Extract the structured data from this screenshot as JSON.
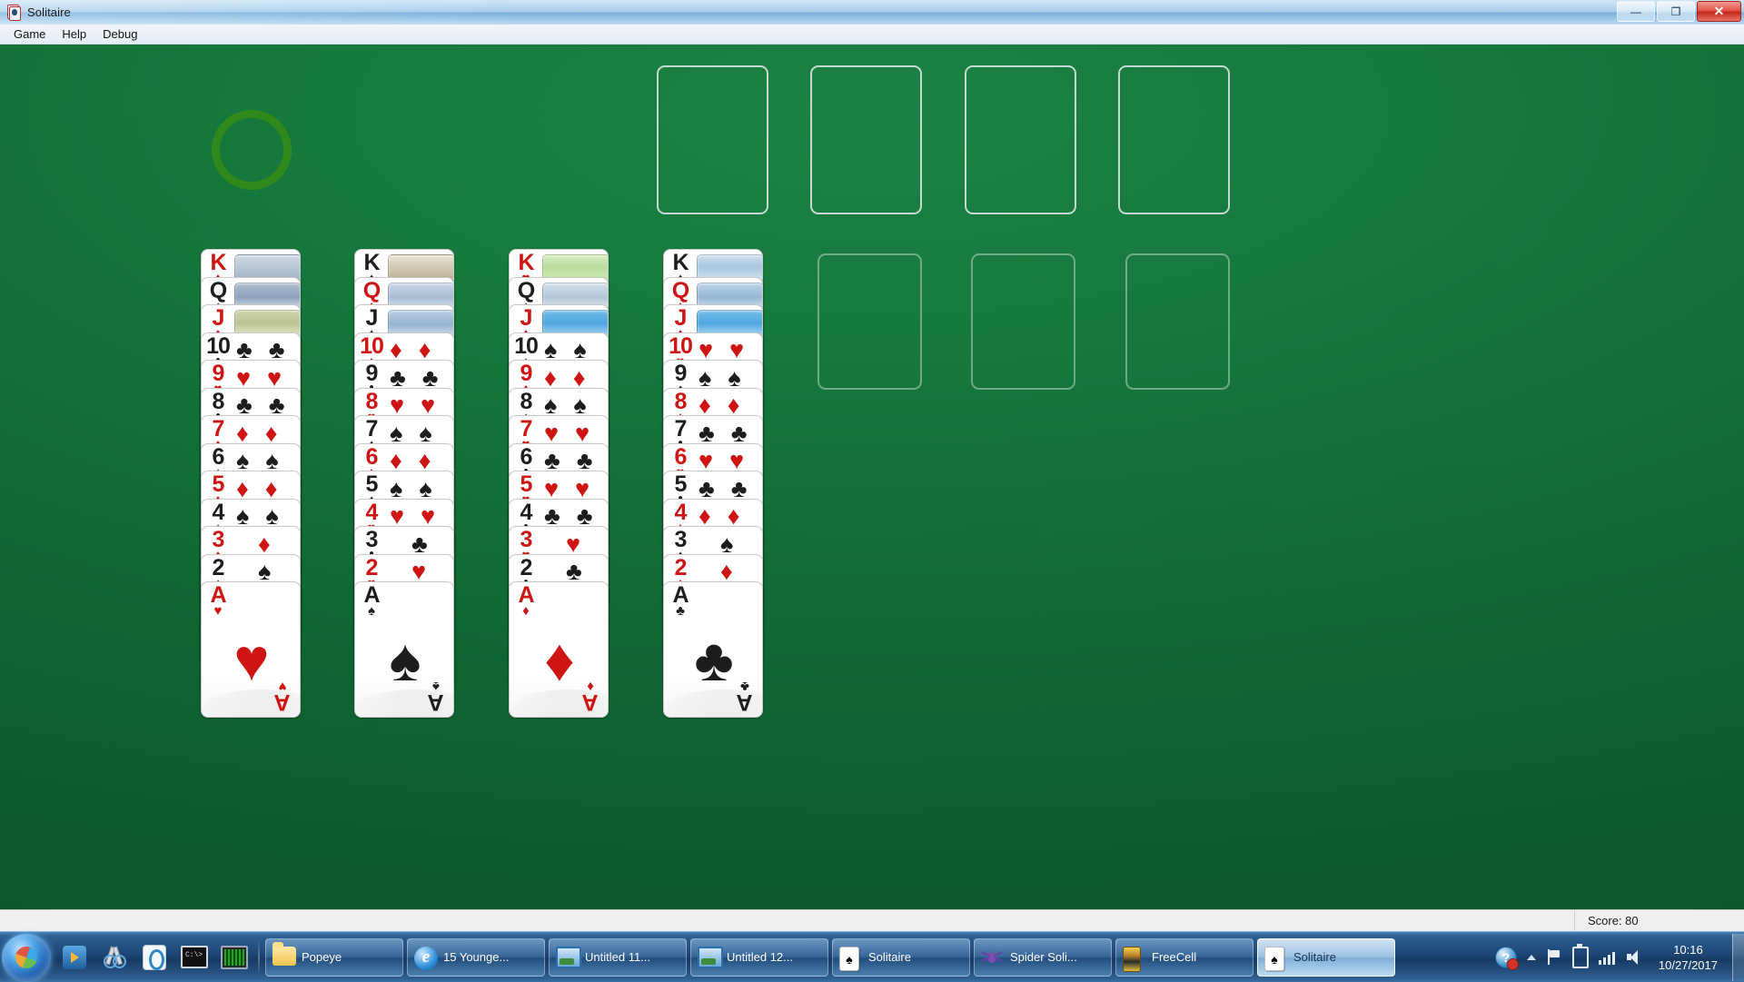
{
  "window": {
    "title": "Solitaire",
    "icon": "solitaire-card-icon",
    "buttons": {
      "minimize": "—",
      "maximize": "❐",
      "close": "✕"
    }
  },
  "menubar": {
    "items": [
      "Game",
      "Help",
      "Debug"
    ]
  },
  "statusbar": {
    "score_label": "Score: 80"
  },
  "board": {
    "stock_icon": "empty-stock-ring",
    "foundations": [
      {
        "name": "foundation-1",
        "empty": true
      },
      {
        "name": "foundation-2",
        "empty": true
      },
      {
        "name": "foundation-3",
        "empty": true
      },
      {
        "name": "foundation-4",
        "empty": true
      }
    ],
    "empty_tableau_slots": [
      {
        "name": "tableau-slot-5",
        "empty": true
      },
      {
        "name": "tableau-slot-6",
        "empty": true
      },
      {
        "name": "tableau-slot-7",
        "empty": true
      }
    ],
    "suit_glyphs": {
      "hearts": "♥",
      "diamonds": "♦",
      "spades": "♠",
      "clubs": "♣"
    },
    "colors": {
      "red": "#cf1414",
      "black": "#1d1d1d",
      "felt": "#14773b",
      "slot_outline": "#ebf0ee",
      "ring": "#2f8a18"
    },
    "columns": [
      {
        "name": "tableau-column-1",
        "cards": [
          {
            "rank": "K",
            "suit": "♦",
            "color": "red",
            "face": true,
            "pic": "pic-k1"
          },
          {
            "rank": "Q",
            "suit": "♠",
            "color": "black",
            "face": true,
            "pic": "pic-q1"
          },
          {
            "rank": "J",
            "suit": "♦",
            "color": "red",
            "face": true,
            "pic": "pic-j1"
          },
          {
            "rank": "10",
            "suit": "♣",
            "color": "black",
            "pips": 2
          },
          {
            "rank": "9",
            "suit": "♥",
            "color": "red",
            "pips": 2
          },
          {
            "rank": "8",
            "suit": "♣",
            "color": "black",
            "pips": 2
          },
          {
            "rank": "7",
            "suit": "♦",
            "color": "red",
            "pips": 2
          },
          {
            "rank": "6",
            "suit": "♠",
            "color": "black",
            "pips": 2
          },
          {
            "rank": "5",
            "suit": "♦",
            "color": "red",
            "pips": 2
          },
          {
            "rank": "4",
            "suit": "♠",
            "color": "black",
            "pips": 2
          },
          {
            "rank": "3",
            "suit": "♦",
            "color": "red",
            "pips": 1
          },
          {
            "rank": "2",
            "suit": "♠",
            "color": "black",
            "pips": 1
          },
          {
            "rank": "A",
            "suit": "♥",
            "color": "red",
            "ace": true
          }
        ]
      },
      {
        "name": "tableau-column-2",
        "cards": [
          {
            "rank": "K",
            "suit": "♠",
            "color": "black",
            "face": true,
            "pic": "pic-k2"
          },
          {
            "rank": "Q",
            "suit": "♦",
            "color": "red",
            "face": true,
            "pic": "pic-q2"
          },
          {
            "rank": "J",
            "suit": "♠",
            "color": "black",
            "face": true,
            "pic": "pic-j2"
          },
          {
            "rank": "10",
            "suit": "♦",
            "color": "red",
            "pips": 2
          },
          {
            "rank": "9",
            "suit": "♣",
            "color": "black",
            "pips": 2
          },
          {
            "rank": "8",
            "suit": "♥",
            "color": "red",
            "pips": 2
          },
          {
            "rank": "7",
            "suit": "♠",
            "color": "black",
            "pips": 2
          },
          {
            "rank": "6",
            "suit": "♦",
            "color": "red",
            "pips": 2
          },
          {
            "rank": "5",
            "suit": "♠",
            "color": "black",
            "pips": 2
          },
          {
            "rank": "4",
            "suit": "♥",
            "color": "red",
            "pips": 2
          },
          {
            "rank": "3",
            "suit": "♣",
            "color": "black",
            "pips": 1
          },
          {
            "rank": "2",
            "suit": "♥",
            "color": "red",
            "pips": 1
          },
          {
            "rank": "A",
            "suit": "♠",
            "color": "black",
            "ace": true
          }
        ]
      },
      {
        "name": "tableau-column-3",
        "cards": [
          {
            "rank": "K",
            "suit": "♥",
            "color": "red",
            "face": true,
            "pic": "pic-k3"
          },
          {
            "rank": "Q",
            "suit": "♠",
            "color": "black",
            "face": true,
            "pic": "pic-q3"
          },
          {
            "rank": "J",
            "suit": "♦",
            "color": "red",
            "face": true,
            "pic": "pic-j3"
          },
          {
            "rank": "10",
            "suit": "♠",
            "color": "black",
            "pips": 2
          },
          {
            "rank": "9",
            "suit": "♦",
            "color": "red",
            "pips": 2
          },
          {
            "rank": "8",
            "suit": "♠",
            "color": "black",
            "pips": 2
          },
          {
            "rank": "7",
            "suit": "♥",
            "color": "red",
            "pips": 2
          },
          {
            "rank": "6",
            "suit": "♣",
            "color": "black",
            "pips": 2
          },
          {
            "rank": "5",
            "suit": "♥",
            "color": "red",
            "pips": 2
          },
          {
            "rank": "4",
            "suit": "♣",
            "color": "black",
            "pips": 2
          },
          {
            "rank": "3",
            "suit": "♥",
            "color": "red",
            "pips": 1
          },
          {
            "rank": "2",
            "suit": "♣",
            "color": "black",
            "pips": 1
          },
          {
            "rank": "A",
            "suit": "♦",
            "color": "red",
            "ace": true
          }
        ]
      },
      {
        "name": "tableau-column-4",
        "cards": [
          {
            "rank": "K",
            "suit": "♠",
            "color": "black",
            "face": true,
            "pic": "pic-k4"
          },
          {
            "rank": "Q",
            "suit": "♦",
            "color": "red",
            "face": true,
            "pic": "pic-q4"
          },
          {
            "rank": "J",
            "suit": "♦",
            "color": "red",
            "face": true,
            "pic": "pic-j4"
          },
          {
            "rank": "10",
            "suit": "♥",
            "color": "red",
            "pips": 2
          },
          {
            "rank": "9",
            "suit": "♠",
            "color": "black",
            "pips": 2
          },
          {
            "rank": "8",
            "suit": "♦",
            "color": "red",
            "pips": 2
          },
          {
            "rank": "7",
            "suit": "♣",
            "color": "black",
            "pips": 2
          },
          {
            "rank": "6",
            "suit": "♥",
            "color": "red",
            "pips": 2
          },
          {
            "rank": "5",
            "suit": "♣",
            "color": "black",
            "pips": 2
          },
          {
            "rank": "4",
            "suit": "♦",
            "color": "red",
            "pips": 2
          },
          {
            "rank": "3",
            "suit": "♠",
            "color": "black",
            "pips": 1
          },
          {
            "rank": "2",
            "suit": "♦",
            "color": "red",
            "pips": 1
          },
          {
            "rank": "A",
            "suit": "♣",
            "color": "black",
            "ace": true
          }
        ]
      }
    ]
  },
  "taskbar": {
    "start_button": "start-orb",
    "quick_launch": [
      {
        "name": "windows-media-player-icon",
        "class": "ic-wmp"
      },
      {
        "name": "snipping-tool-icon",
        "class": "ic-snip"
      },
      {
        "name": "windows-live-writer-icon",
        "class": "ic-wlink"
      },
      {
        "name": "command-prompt-icon",
        "class": "ic-term"
      },
      {
        "name": "system-monitor-icon",
        "class": "ic-mon"
      }
    ],
    "buttons": [
      {
        "label": "Popeye",
        "icon": "folder-icon",
        "icon_class": "ic-folder",
        "active": false
      },
      {
        "label": "15 Younge...",
        "icon": "internet-explorer-icon",
        "icon_class": "ic-ie",
        "active": false
      },
      {
        "label": "Untitled 11...",
        "icon": "picture-icon",
        "icon_class": "ic-pic",
        "active": false
      },
      {
        "label": "Untitled 12...",
        "icon": "picture-icon",
        "icon_class": "ic-pic",
        "active": false
      },
      {
        "label": "Solitaire",
        "icon": "solitaire-card-icon",
        "icon_class": "ic-card",
        "active": false
      },
      {
        "label": "Spider Soli...",
        "icon": "spider-solitaire-icon",
        "icon_class": "ic-spider",
        "active": false
      },
      {
        "label": "FreeCell",
        "icon": "freecell-icon",
        "icon_class": "ic-free",
        "active": false
      },
      {
        "label": "Solitaire",
        "icon": "solitaire-card-icon",
        "icon_class": "ic-card",
        "active": true
      }
    ],
    "tray": {
      "icons": [
        "action-center-icon",
        "show-hidden-icons-chevron",
        "flag-icon",
        "usb-device-icon",
        "network-signal-icon",
        "volume-speaker-icon"
      ],
      "time": "10:16",
      "date": "10/27/2017"
    }
  }
}
